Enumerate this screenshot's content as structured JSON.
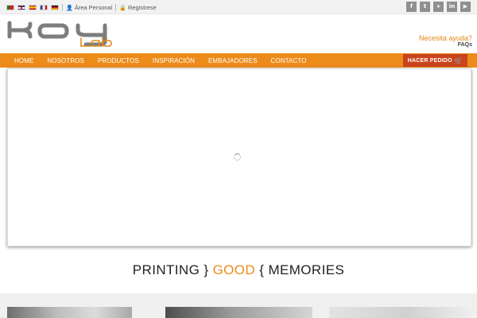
{
  "topbar": {
    "flags": [
      {
        "name": "pt-flag-icon"
      },
      {
        "name": "gb-flag-icon"
      },
      {
        "name": "es-flag-icon"
      },
      {
        "name": "fr-flag-icon"
      },
      {
        "name": "de-flag-icon"
      }
    ],
    "area_personal": "Área Personal",
    "registrese": "Registrese",
    "socials": [
      {
        "name": "facebook-icon",
        "glyph": "f"
      },
      {
        "name": "twitter-icon",
        "glyph": "t"
      },
      {
        "name": "google-plus-icon",
        "glyph": "+"
      },
      {
        "name": "linkedin-icon",
        "glyph": "in"
      },
      {
        "name": "youtube-icon",
        "glyph": "▶"
      }
    ]
  },
  "header": {
    "logo_text": "Koy",
    "logo_sub": "Lab",
    "help_question": "Necesita ayuda?",
    "faqs": "FAQs"
  },
  "nav": {
    "items": [
      "HOME",
      "NOSOTROS",
      "PRODUCTOS",
      "INSPIRACIÓN",
      "EMBAJADORES",
      "CONTACTO"
    ],
    "order_button": "HACER PEDIDO"
  },
  "tagline": {
    "part1": "PRINTING",
    "brace1": "}",
    "good": "GOOD",
    "brace2": "{",
    "part2": "MEMORIES"
  },
  "colors": {
    "accent": "#ed8b1a",
    "order_button": "#c9431c",
    "social_bg": "#8f8f8f"
  }
}
